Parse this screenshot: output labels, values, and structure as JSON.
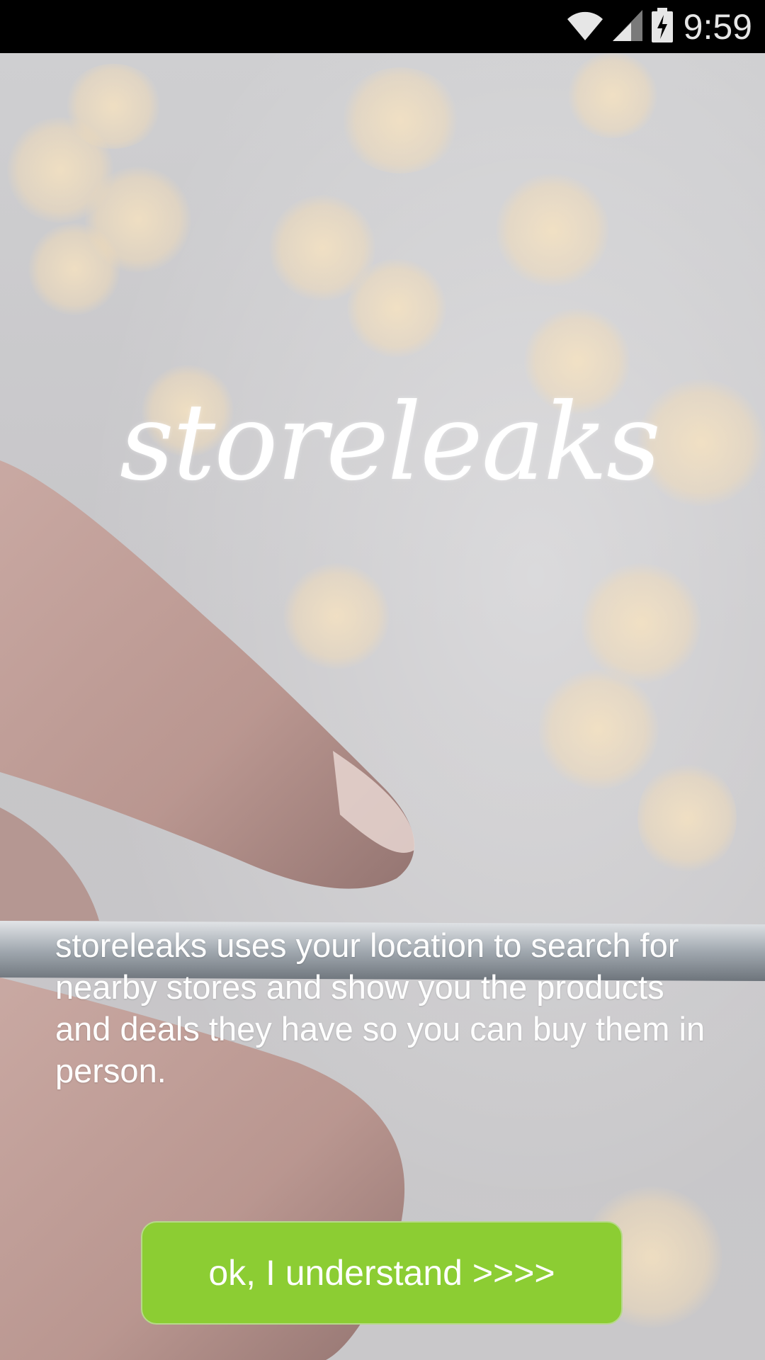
{
  "status_bar": {
    "time": "9:59",
    "icons": [
      "wifi-icon",
      "cell-signal-icon",
      "battery-charging-icon"
    ]
  },
  "logo": {
    "text": "storeleaks"
  },
  "description": {
    "text": "storeleaks uses your location to search for nearby stores and show you the products and deals they have so you can buy them in person."
  },
  "confirm_button": {
    "label": "ok, I understand >>>>"
  },
  "colors": {
    "button_background": "#8ccd33",
    "status_bar_background": "#000000",
    "text": "#ffffff"
  }
}
